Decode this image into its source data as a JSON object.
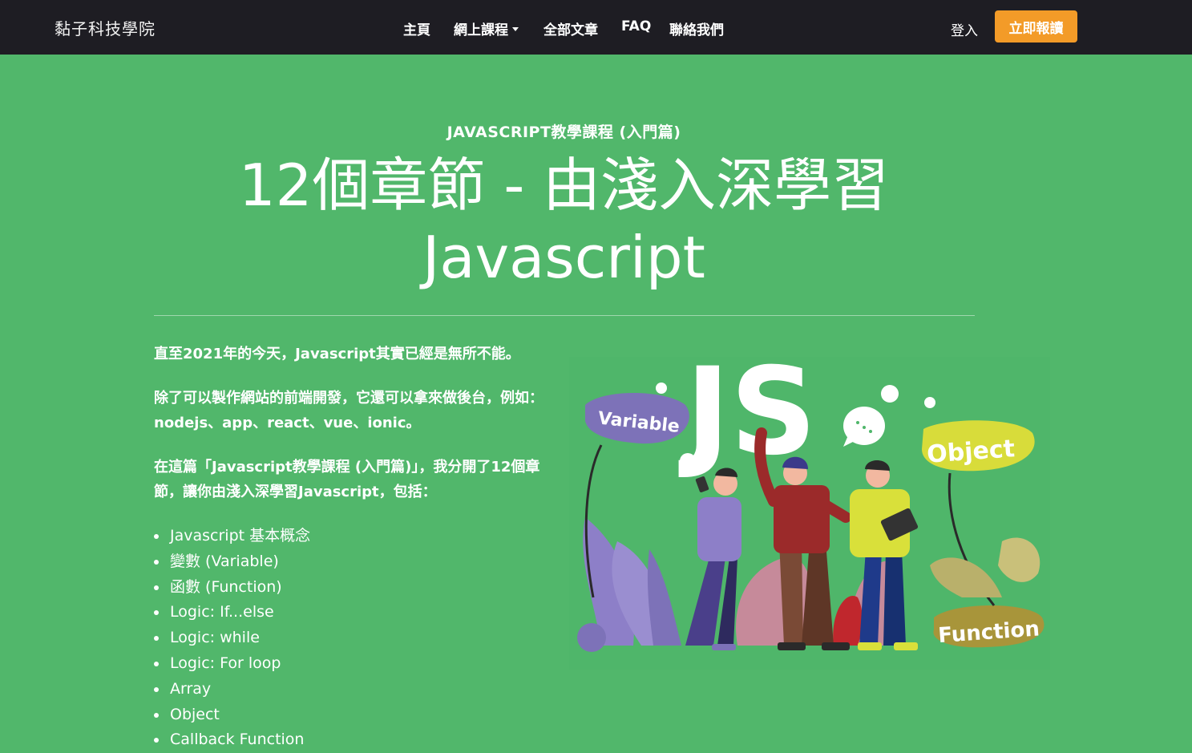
{
  "nav": {
    "brand": "黏子科技學院",
    "links": [
      {
        "label": "主頁",
        "dropdown": false
      },
      {
        "label": "網上課程",
        "dropdown": true
      },
      {
        "label": "全部文章",
        "dropdown": false
      },
      {
        "label": "FAQ",
        "dropdown": false
      },
      {
        "label": "聯絡我們",
        "dropdown": false
      }
    ],
    "login": "登入",
    "cta": "立即報讀"
  },
  "hero": {
    "eyebrow": "JAVASCRIPT教學課程 (入門篇)",
    "title_line1": "12個章節 - 由淺入深學習",
    "title_line2": "Javascript"
  },
  "content": {
    "paragraphs": [
      "直至2021年的今天，Javascript其實已經是無所不能。",
      "除了可以製作網站的前端開發，它還可以拿來做後台，例如：nodejs、app、react、vue、ionic。",
      "在這篇「Javascript教學課程 (入門篇)」，我分開了12個章節，讓你由淺入深學習Javascript，包括："
    ],
    "topics": [
      "Javascript 基本概念",
      "變數 (Variable)",
      "函數 (Function)",
      "Logic: If...else",
      "Logic: while",
      "Logic: For loop",
      "Array",
      "Object",
      "Callback Function"
    ]
  },
  "illustration": {
    "labels": {
      "js": "JS",
      "variable": "Variable",
      "object": "Object",
      "function": "Function"
    },
    "colors": {
      "background": "#4fb66a",
      "variable_blob": "#7d72b8",
      "object_blob": "#d8dc3a",
      "function_blob": "#a8953a",
      "person_red": "#9b2a2a",
      "person_yellow": "#d9e03a"
    }
  },
  "colors": {
    "page_bg": "#51b76b",
    "navbar_bg": "#1e1d23",
    "cta_bg": "#f39b28"
  }
}
